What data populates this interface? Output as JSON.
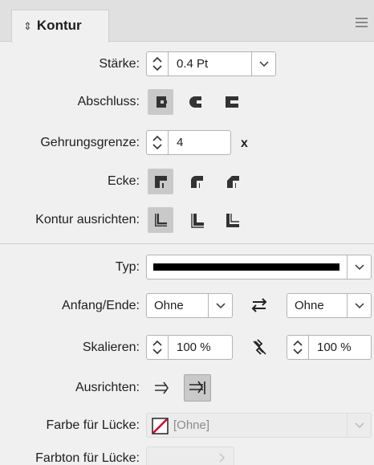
{
  "panel": {
    "title": "Kontur",
    "title_icon": "double-arrow-icon",
    "menu_icon": "panel-menu-icon"
  },
  "fields": {
    "staerke": {
      "label": "Stärke:",
      "value": "0.4 Pt"
    },
    "abschluss": {
      "label": "Abschluss:",
      "selected": 0,
      "options": [
        "butt-cap-icon",
        "round-cap-icon",
        "projecting-cap-icon"
      ]
    },
    "gehrungsgrenze": {
      "label": "Gehrungsgrenze:",
      "value": "4",
      "unit": "x"
    },
    "ecke": {
      "label": "Ecke:",
      "selected": 0,
      "options": [
        "miter-join-icon",
        "round-join-icon",
        "bevel-join-icon"
      ]
    },
    "kontur_ausrichten": {
      "label": "Kontur ausrichten:",
      "selected": 0,
      "options": [
        "align-center-icon",
        "align-inside-icon",
        "align-outside-icon"
      ]
    },
    "typ": {
      "label": "Typ:"
    },
    "anfang_ende": {
      "label": "Anfang/Ende:",
      "start": "Ohne",
      "end": "Ohne"
    },
    "skalieren": {
      "label": "Skalieren:",
      "start": "100 %",
      "end": "100 %"
    },
    "ausrichten": {
      "label": "Ausrichten:",
      "selected": 1
    },
    "farbe_luecke": {
      "label": "Farbe für Lücke:",
      "value": "[Ohne]"
    },
    "farbton_luecke": {
      "label": "Farbton für Lücke:"
    }
  },
  "colors": {
    "panel_bg": "#f0f0f0",
    "swatch_none_red": "#d9002c"
  }
}
